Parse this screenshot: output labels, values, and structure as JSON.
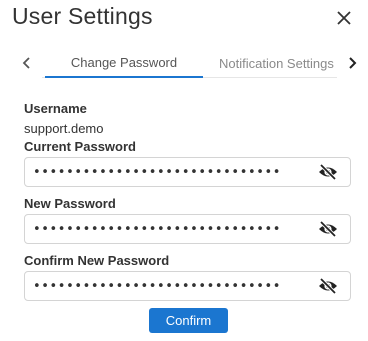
{
  "dialog": {
    "title": "User Settings"
  },
  "icons": {
    "close": "close-icon",
    "prev": "chevron-left-icon",
    "next": "chevron-right-icon",
    "toggle_visibility": "eye-slash-icon"
  },
  "tabs": [
    {
      "label": "Change Password",
      "active": true
    },
    {
      "label": "Notification Settings",
      "active": false
    }
  ],
  "form": {
    "username_label": "Username",
    "username_value": "support.demo",
    "current_password_label": "Current Password",
    "current_password_value": "••••••••••••••••••••••••••••••",
    "new_password_label": "New Password",
    "new_password_value": "••••••••••••••••••••••••••••••",
    "confirm_password_label": "Confirm New Password",
    "confirm_password_value": "••••••••••••••••••••••••••••••",
    "confirm_button": "Confirm"
  },
  "colors": {
    "accent": "#1b76d0",
    "border": "#d4d4d4",
    "tab_line": "#e6e6e6"
  }
}
